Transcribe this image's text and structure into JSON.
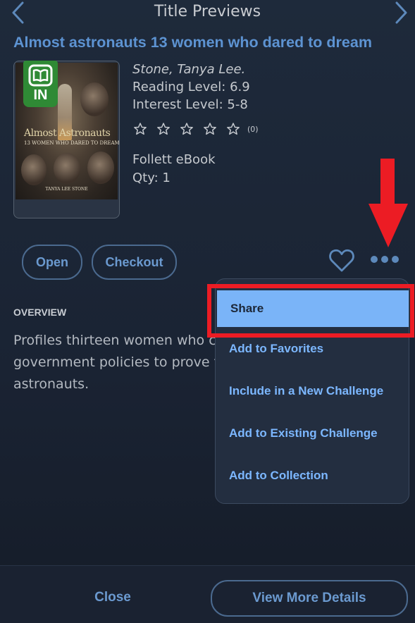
{
  "header": {
    "title": "Title Previews",
    "prev_icon": "chevron-left-icon",
    "next_icon": "chevron-right-icon"
  },
  "book": {
    "title": "Almost astronauts 13 women who dared to dream",
    "author": "Stone, Tanya Lee.",
    "reading_level": "Reading Level: 6.9",
    "interest_level": "Interest Level: 5-8",
    "rating_stars": 0,
    "rating_count": "(0)",
    "format": "Follett eBook",
    "qty": "Qty: 1",
    "availability_badge": "IN",
    "cover": {
      "title_line1": "Almost Astronauts",
      "title_line2": "13 WOMEN WHO DARED TO DREAM",
      "author_line": "TANYA LEE STONE"
    }
  },
  "actions": {
    "open_label": "Open",
    "checkout_label": "Checkout",
    "favorite_icon": "heart-icon",
    "more_icon": "more-horizontal-icon"
  },
  "overview": {
    "label": "OVERVIEW",
    "lines": [
      "Profiles thirteen women who ch",
      "government policies to prove th",
      "astronauts."
    ]
  },
  "menu": {
    "items": [
      {
        "label": "Share",
        "selected": true
      },
      {
        "label": "Add to Favorites",
        "selected": false
      },
      {
        "label": "Include in a New Challenge",
        "selected": false
      },
      {
        "label": "Add to Existing Challenge",
        "selected": false
      },
      {
        "label": "Add to Collection",
        "selected": false
      }
    ]
  },
  "footer": {
    "close_label": "Close",
    "details_label": "View More Details"
  },
  "colors": {
    "background": "#1b2434",
    "accent": "#6b9ad0",
    "title_blue": "#5d93d2",
    "menu_selected": "#7ab4f8",
    "annotation_red": "#ec1c24",
    "badge_green": "#2f8a35"
  }
}
